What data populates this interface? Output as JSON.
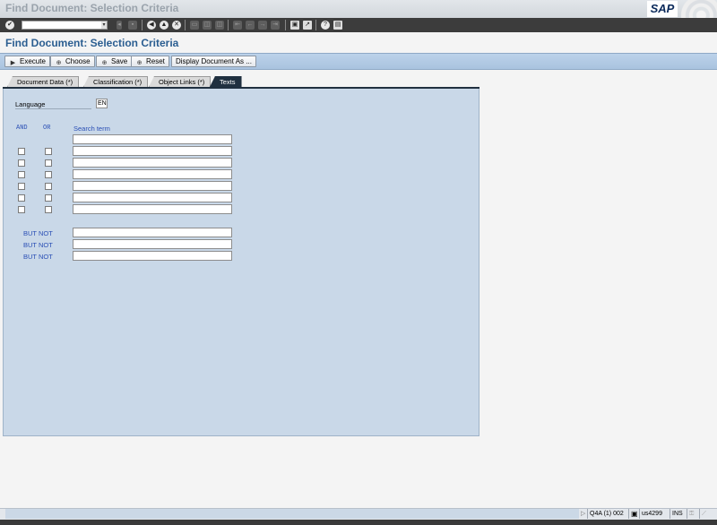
{
  "window": {
    "title": "Find Document: Selection Criteria",
    "logo_text": "SAP"
  },
  "standard_toolbar": {
    "command_field_value": "",
    "icons": [
      "enter-icon",
      "save-icon",
      "back-icon",
      "exit-icon",
      "cancel-icon",
      "print-icon",
      "find-icon",
      "find-next-icon",
      "first-page-icon",
      "previous-page-icon",
      "next-page-icon",
      "last-page-icon",
      "create-session-icon",
      "shortcut-icon",
      "help-icon",
      "layout-menu-icon"
    ]
  },
  "page": {
    "title": "Find Document: Selection Criteria"
  },
  "app_toolbar": {
    "buttons": [
      {
        "label": "Execute",
        "icon": "execute-icon"
      },
      {
        "label": "Choose",
        "icon": "choose-icon"
      },
      {
        "label": "Save",
        "icon": "save-icon"
      },
      {
        "label": "Reset",
        "icon": "reset-icon"
      },
      {
        "label": "Display Document As ..."
      }
    ]
  },
  "tabs": [
    {
      "label": "Document Data (*)",
      "active": false
    },
    {
      "label": "Classification (*)",
      "active": false
    },
    {
      "label": "Object Links (*)",
      "active": false
    },
    {
      "label": "Texts",
      "active": true
    }
  ],
  "form": {
    "language_label": "Language",
    "language_value": "EN",
    "and_header": "AND",
    "or_header": "OR",
    "search_term_header": "Search term",
    "search_terms": [
      "",
      "",
      "",
      "",
      "",
      "",
      ""
    ],
    "but_not_label": "BUT NOT",
    "but_not_terms": [
      "",
      "",
      ""
    ]
  },
  "status_bar": {
    "message": "",
    "system": "Q4A (1) 002",
    "server": "us4299",
    "mode": "INS"
  },
  "colors": {
    "accent": "#2b5e91",
    "panel": "#c9d8e8",
    "app_toolbar": "#b4cbe5",
    "label_blue": "#2a4fb5"
  }
}
